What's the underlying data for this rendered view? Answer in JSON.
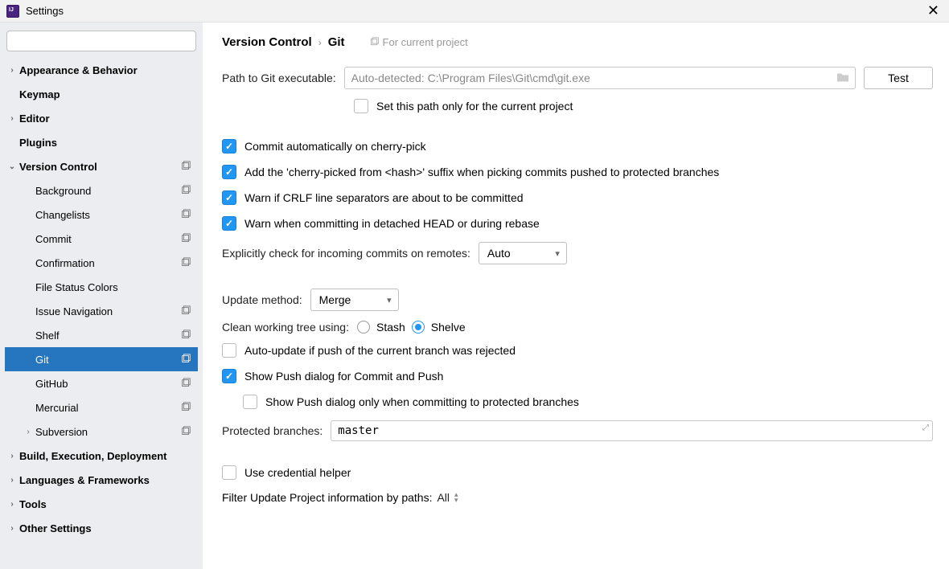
{
  "window": {
    "title": "Settings"
  },
  "sidebar": {
    "search_placeholder": "",
    "items": [
      {
        "label": "Appearance & Behavior",
        "level": 0,
        "chevron": ">",
        "bold": true
      },
      {
        "label": "Keymap",
        "level": 0,
        "chevron": "",
        "bold": true
      },
      {
        "label": "Editor",
        "level": 0,
        "chevron": ">",
        "bold": true
      },
      {
        "label": "Plugins",
        "level": 0,
        "chevron": "",
        "bold": true
      },
      {
        "label": "Version Control",
        "level": 0,
        "chevron": "v",
        "bold": true,
        "badge": true
      },
      {
        "label": "Background",
        "level": 1,
        "badge": true
      },
      {
        "label": "Changelists",
        "level": 1,
        "badge": true
      },
      {
        "label": "Commit",
        "level": 1,
        "badge": true
      },
      {
        "label": "Confirmation",
        "level": 1,
        "badge": true
      },
      {
        "label": "File Status Colors",
        "level": 1
      },
      {
        "label": "Issue Navigation",
        "level": 1,
        "badge": true
      },
      {
        "label": "Shelf",
        "level": 1,
        "badge": true
      },
      {
        "label": "Git",
        "level": 1,
        "badge": true,
        "selected": true
      },
      {
        "label": "GitHub",
        "level": 1,
        "badge": true
      },
      {
        "label": "Mercurial",
        "level": 1,
        "badge": true
      },
      {
        "label": "Subversion",
        "level": 1,
        "chevron": ">",
        "badge": true
      },
      {
        "label": "Build, Execution, Deployment",
        "level": 0,
        "chevron": ">",
        "bold": true
      },
      {
        "label": "Languages & Frameworks",
        "level": 0,
        "chevron": ">",
        "bold": true
      },
      {
        "label": "Tools",
        "level": 0,
        "chevron": ">",
        "bold": true
      },
      {
        "label": "Other Settings",
        "level": 0,
        "chevron": ">",
        "bold": true
      }
    ]
  },
  "breadcrumb": {
    "part1": "Version Control",
    "part2": "Git",
    "scope": "For current project"
  },
  "git": {
    "path_label": "Path to Git executable:",
    "path_value": "Auto-detected: C:\\Program Files\\Git\\cmd\\git.exe",
    "test_btn": "Test",
    "set_path_current": "Set this path only for the current project",
    "cherry_pick_auto": "Commit automatically on cherry-pick",
    "cherry_pick_suffix": "Add the 'cherry-picked from <hash>' suffix when picking commits pushed to protected branches",
    "warn_crlf": "Warn if CRLF line separators are about to be committed",
    "warn_detached": "Warn when committing in detached HEAD or during rebase",
    "explicit_check_label": "Explicitly check for incoming commits on remotes:",
    "explicit_check_value": "Auto",
    "update_method_label": "Update method:",
    "update_method_value": "Merge",
    "clean_tree_label": "Clean working tree using:",
    "clean_tree_stash": "Stash",
    "clean_tree_shelve": "Shelve",
    "auto_update_push": "Auto-update if push of the current branch was rejected",
    "show_push_commit": "Show Push dialog for Commit and Push",
    "show_push_protected": "Show Push dialog only when committing to protected branches",
    "protected_label": "Protected branches:",
    "protected_value": "master",
    "credential_helper": "Use credential helper",
    "filter_label": "Filter Update Project information by paths:",
    "filter_value": "All"
  }
}
